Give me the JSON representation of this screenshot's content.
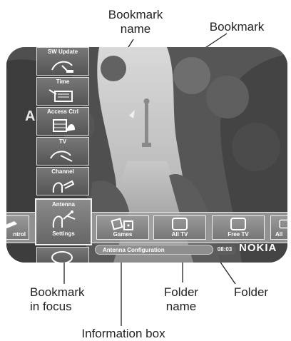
{
  "callouts": {
    "bookmark_name": "Bookmark\nname",
    "bookmark": "Bookmark",
    "bookmark_in_focus": "Bookmark\nin focus",
    "folder_name": "Folder\nname",
    "folder": "Folder",
    "information_box": "Information box"
  },
  "screen": {
    "ghost_text": "A",
    "bookmarks": [
      {
        "label": "SW Update",
        "icon": "satellite-dish-icon"
      },
      {
        "label": "Time",
        "icon": "clock-icon"
      },
      {
        "label": "Access Ctrl",
        "icon": "card-hand-icon"
      },
      {
        "label": "TV",
        "icon": "satellite-dish-icon"
      },
      {
        "label": "Channel",
        "icon": "channel-hand-icon"
      }
    ],
    "focused_bookmark": {
      "top_label": "Antenna",
      "bottom_label": "Settings",
      "icon": "antenna-hand-icon"
    },
    "folders": [
      {
        "label": "ntrol",
        "icon": "remote-icon"
      },
      {
        "label": "Games",
        "icon": "dice-icon"
      },
      {
        "label": "All TV",
        "icon": "tv-icon"
      },
      {
        "label": "Free TV",
        "icon": "tv-icon"
      },
      {
        "label": "All",
        "icon": "tv-icon"
      }
    ],
    "info_text": "Antenna Configuration",
    "time": "08:03",
    "brand": "NOKIA"
  }
}
